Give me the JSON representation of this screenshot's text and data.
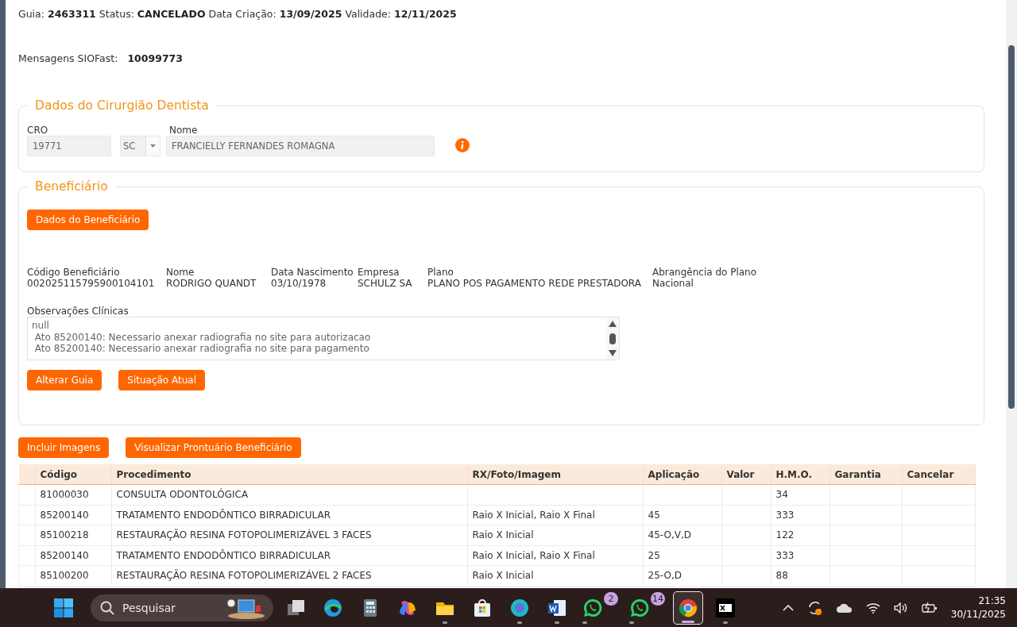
{
  "header": {
    "fields": [
      {
        "label": "Guia:",
        "value": "2463311"
      },
      {
        "label": "Status:",
        "value": "CANCELADO"
      },
      {
        "label": "Data Criação:",
        "value": "13/09/2025"
      },
      {
        "label": "Validade:",
        "value": "12/11/2025"
      }
    ]
  },
  "messages": {
    "label": "Mensagens SIOFast:",
    "value": "10099773"
  },
  "dentist": {
    "legend": "Dados do Cirurgião Dentista",
    "cro": {
      "label": "CRO",
      "value": "19771"
    },
    "uf": {
      "value": "SC"
    },
    "name": {
      "label": "Nome",
      "value": "FRANCIELLY FERNANDES ROMAGNA"
    }
  },
  "beneficiary": {
    "legend": "Beneficiário",
    "button": "Dados do Beneficiário",
    "fields": [
      {
        "label": "Código Beneficiário",
        "value": "002025115795900104101"
      },
      {
        "label": "Nome",
        "value": "RODRIGO QUANDT"
      },
      {
        "label": "Data Nascimento",
        "value": "03/10/1978"
      },
      {
        "label": "Empresa",
        "value": "SCHULZ SA"
      },
      {
        "label": "Plano",
        "value": "PLANO POS PAGAMENTO REDE PRESTADORA"
      },
      {
        "label": "Abrangência do Plano",
        "value": "Nacional"
      }
    ],
    "observations": {
      "label": "Observações Clínicas",
      "lines": [
        "null",
        " Ato 85200140: Necessario anexar radiografia no site para autorizacao",
        " Ato 85200140: Necessario anexar radiografia no site para pagamento"
      ]
    },
    "buttons": [
      "Alterar Guia",
      "Situação Atual"
    ]
  },
  "actions": [
    "Incluir Imagens",
    "Visualizar Prontuário Beneficiário"
  ],
  "table": {
    "columns": [
      "",
      "Código",
      "Procedimento",
      "RX/Foto/Imagem",
      "Aplicação",
      "Valor",
      "H.M.O.",
      "Garantia",
      "Cancelar"
    ],
    "rows": [
      [
        "",
        "81000030",
        "CONSULTA ODONTOLÓGICA",
        "",
        "",
        "",
        "34",
        "",
        ""
      ],
      [
        "",
        "85200140",
        "TRATAMENTO ENDODÔNTICO BIRRADICULAR",
        "Raio X Inicial, Raio X Final",
        "45",
        "",
        "333",
        "",
        ""
      ],
      [
        "",
        "85100218",
        "RESTAURAÇÃO RESINA FOTOPOLIMERIZÁVEL 3 FACES",
        "Raio X Inicial",
        "45-O,V,D",
        "",
        "122",
        "",
        ""
      ],
      [
        "",
        "85200140",
        "TRATAMENTO ENDODÔNTICO BIRRADICULAR",
        "Raio X Inicial, Raio X Final",
        "25",
        "",
        "333",
        "",
        ""
      ],
      [
        "",
        "85100200",
        "RESTAURAÇÃO RESINA FOTOPOLIMERIZÁVEL 2 FACES",
        "Raio X Inicial",
        "25-O,D",
        "",
        "88",
        "",
        ""
      ]
    ]
  },
  "taskbar": {
    "search": {
      "placeholder": "Pesquisar"
    },
    "apps": [
      {
        "kind": "taskview",
        "running": false,
        "selected": false
      },
      {
        "kind": "edge",
        "running": false,
        "selected": false
      },
      {
        "kind": "calculator",
        "running": false,
        "selected": false
      },
      {
        "kind": "copilot",
        "running": false,
        "selected": false
      },
      {
        "kind": "folder",
        "running": true,
        "selected": false
      },
      {
        "kind": "store",
        "running": false,
        "selected": false
      },
      {
        "kind": "canva",
        "running": true,
        "selected": false
      },
      {
        "kind": "word",
        "running": true,
        "selected": false
      },
      {
        "kind": "chat",
        "running": true,
        "selected": false,
        "badge": "2"
      },
      {
        "kind": "chat",
        "running": true,
        "selected": false,
        "badge": "14"
      },
      {
        "kind": "chrome",
        "running": true,
        "selected": true
      },
      {
        "kind": "xp",
        "running": true,
        "selected": false
      }
    ],
    "clock": {
      "time": "21:35",
      "date": "30/11/2025"
    }
  }
}
